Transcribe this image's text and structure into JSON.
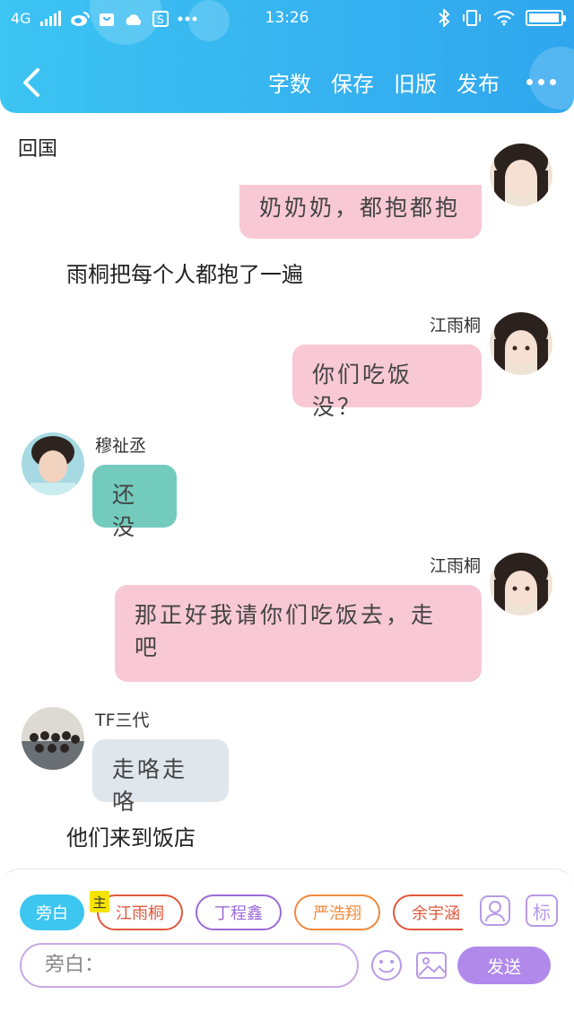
{
  "status_bar": {
    "network": "4G",
    "time": "13:26",
    "battery_level": 0.96,
    "icons": [
      "signal-icon",
      "weibo-icon",
      "bag-icon",
      "cloud-icon",
      "s-app-icon",
      "more-dots-icon",
      "bluetooth-icon",
      "vibrate-icon",
      "wifi-icon",
      "battery-icon"
    ]
  },
  "header": {
    "back_icon": "chevron-left-icon",
    "actions": [
      "字数",
      "保存",
      "旧版",
      "发布"
    ],
    "more_icon": "more-horizontal-icon"
  },
  "chat": {
    "narration_top": "回国",
    "msg1": {
      "text": "奶奶奶，都抱都抱"
    },
    "narration_2": "雨桐把每个人都抱了一遍",
    "msg2": {
      "speaker": "江雨桐",
      "text": "你们吃饭没？"
    },
    "msg3": {
      "speaker": "穆祉丞",
      "text": "还没"
    },
    "msg4": {
      "speaker": "江雨桐",
      "line1": "那正好我请你们吃饭去，走",
      "line2": "吧"
    },
    "msg5": {
      "speaker": "TF三代",
      "text": "走咯走咯"
    },
    "narration_3": "他们来到饭店",
    "colors": {
      "pink": "#f8c9d4",
      "teal": "#73cbbe",
      "grey": "#dfe6ec"
    }
  },
  "composer": {
    "chips": [
      {
        "label": "旁白",
        "color": "#3cc6f0"
      },
      {
        "label": "江雨桐",
        "color": "#e0573c"
      },
      {
        "label": "丁程鑫",
        "color": "#9b6ad6"
      },
      {
        "label": "严浩翔",
        "color": "#f08a3c"
      },
      {
        "label": "余宇涵",
        "color": "#e0573c"
      }
    ],
    "main_tag": "主",
    "contact_icon": "person-add-icon",
    "tag_icon_label": "标",
    "input_placeholder": "旁白：",
    "emoji_icon": "smiley-icon",
    "image_icon": "image-icon",
    "send_label": "发送",
    "accent": "#b089ea"
  }
}
